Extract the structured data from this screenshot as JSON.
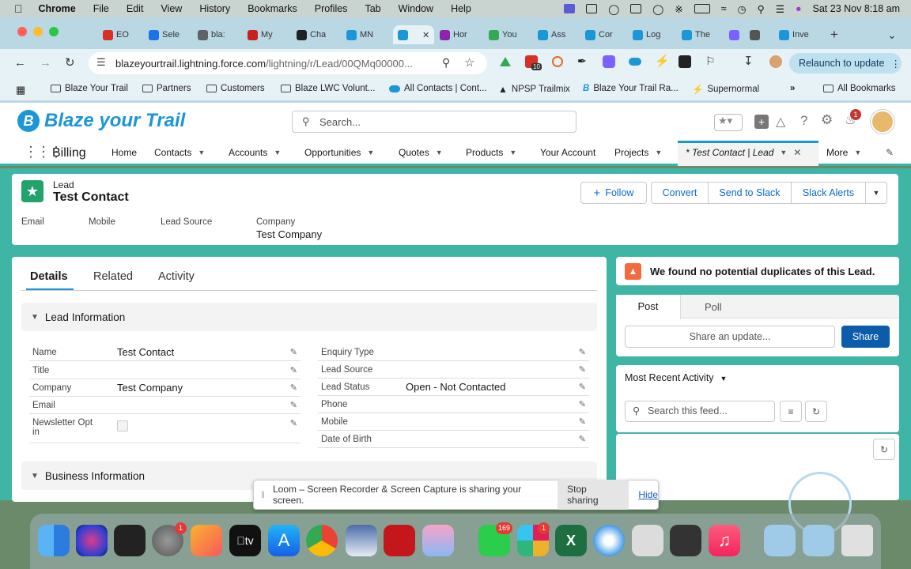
{
  "menubar": {
    "app": "Chrome",
    "items": [
      "File",
      "Edit",
      "View",
      "History",
      "Bookmarks",
      "Profiles",
      "Tab",
      "Window",
      "Help"
    ],
    "datetime": "Sat 23 Nov  8:18 am"
  },
  "tabs": [
    {
      "label": "EO",
      "color": "#d93025"
    },
    {
      "label": "Sele",
      "color": "#1a73e8"
    },
    {
      "label": "bla:",
      "color": "#5f6368"
    },
    {
      "label": "My",
      "color": "#c5221f"
    },
    {
      "label": "Cha",
      "color": "#202124"
    },
    {
      "label": "MN",
      "color": "#1b96d6"
    },
    {
      "label": "",
      "color": "#1b96d6",
      "active": true
    },
    {
      "label": "Hor",
      "color": "#8e24aa"
    },
    {
      "label": "You",
      "color": "#34a853"
    },
    {
      "label": "Ass",
      "color": "#1b96d6"
    },
    {
      "label": "Cor",
      "color": "#1b96d6"
    },
    {
      "label": "Log",
      "color": "#1b96d6"
    },
    {
      "label": "The",
      "color": "#1b96d6"
    },
    {
      "label": "",
      "color": "#7b61ff"
    },
    {
      "label": "",
      "color": "#555"
    },
    {
      "label": "Inve",
      "color": "#1b96d6"
    }
  ],
  "address": {
    "host": "blazeyourtrail.lightning.force.com",
    "path": "/lightning/r/Lead/00QMq00000..."
  },
  "relaunch": "Relaunch to update",
  "bookmarks": [
    "Blaze Your Trail",
    "Partners",
    "Customers",
    "Blaze LWC Volunt...",
    "All Contacts | Cont...",
    "NPSP Trailmix",
    "Blaze Your Trail Ra...",
    "Supernormal"
  ],
  "all_bookmarks": "All Bookmarks",
  "sf": {
    "logo": "Blaze your Trail",
    "search_placeholder": "Search...",
    "notif_count": "1",
    "app_name": "Billing",
    "nav": [
      "Home",
      "Contacts",
      "Accounts",
      "Opportunities",
      "Quotes",
      "Products",
      "Your Account",
      "Projects"
    ],
    "active_tab": "* Test Contact | Lead",
    "more": "More"
  },
  "record": {
    "type": "Lead",
    "name": "Test Contact",
    "actions": {
      "follow": "Follow",
      "convert": "Convert",
      "send_slack": "Send to Slack",
      "slack_alerts": "Slack Alerts"
    },
    "highlights": {
      "email_label": "Email",
      "mobile_label": "Mobile",
      "source_label": "Lead Source",
      "company_label": "Company",
      "company_value": "Test Company"
    },
    "tabs": [
      "Details",
      "Related",
      "Activity"
    ],
    "section1": "Lead Information",
    "section2": "Business Information",
    "left_fields": [
      {
        "label": "Name",
        "value": "Test Contact"
      },
      {
        "label": "Title",
        "value": ""
      },
      {
        "label": "Company",
        "value": "Test Company"
      },
      {
        "label": "Email",
        "value": ""
      },
      {
        "label": "Newsletter Opt in",
        "value": ""
      }
    ],
    "right_fields": [
      {
        "label": "Enquiry Type",
        "value": ""
      },
      {
        "label": "Lead Source",
        "value": ""
      },
      {
        "label": "Lead Status",
        "value": "Open - Not Contacted"
      },
      {
        "label": "Phone",
        "value": ""
      },
      {
        "label": "Mobile",
        "value": ""
      },
      {
        "label": "Date of Birth",
        "value": ""
      }
    ]
  },
  "side": {
    "duplicates": "We found no potential duplicates of this Lead.",
    "post": "Post",
    "poll": "Poll",
    "share_placeholder": "Share an update...",
    "share": "Share",
    "recent": "Most Recent Activity",
    "feed_search": "Search this feed..."
  },
  "loom": {
    "message": "Loom – Screen Recorder & Screen Capture is sharing your screen.",
    "stop": "Stop sharing",
    "hide": "Hide"
  },
  "dock_badges": {
    "settings": "1",
    "messages": "169",
    "slack": "1"
  },
  "omnibar_badge": "10"
}
